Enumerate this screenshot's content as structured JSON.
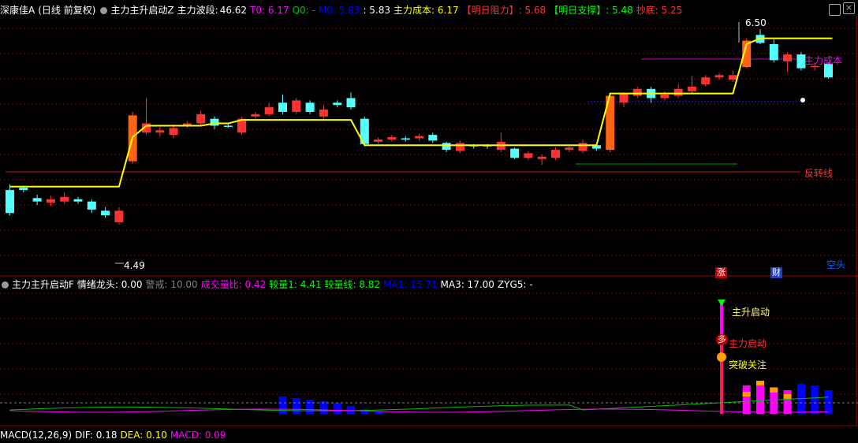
{
  "header": {
    "stock": "深康佳A",
    "period": "(日线 前复权)",
    "indicator": "主力主升启动Z",
    "wave_label": "主力波段:",
    "wave_value": "46.62",
    "t0": "T0: 6.17",
    "q0": "Q0: -",
    "m0": "M0: 5.83",
    "m0b": ": 5.83",
    "cost": "主力成本: 6.17",
    "resist": "【明日阻力】: 5.68",
    "support": "【明日支撑】: 5.48",
    "bottom": "抄底: 5.25",
    "close_icon": "×"
  },
  "labels": {
    "high": "6.50",
    "low": "4.49",
    "cost_line": "主力成本",
    "reversal_line": "反转线",
    "short": "空头",
    "zhang": "涨",
    "cai": "财"
  },
  "sub": {
    "indicator": "主力主升启动F",
    "mood": "情绪龙头: 0.00",
    "alert": "警戒: 10.00",
    "vol_ratio": "成交量比: 0.42",
    "vol1": "较量1: 4.41",
    "vol_line": "较量线: 8.82",
    "ma1": "MA1: 15.71",
    "ma3": "MA3: 17.00",
    "zyg": "ZYG5: -",
    "sig1": "主升启动",
    "sig2": "主力启动",
    "sig3": "突破关注",
    "duo": "多"
  },
  "footer": {
    "macd": "MACD(12,26,9)",
    "dif": "DIF: 0.18",
    "dea": "DEA: 0.10",
    "macd_v": "MACD: 0.09"
  },
  "colors": {
    "up": "#ff3232",
    "down": "#54ffff",
    "cost": "#ffff00",
    "grid": "#800000"
  },
  "candles": [
    {
      "o": 5.1,
      "c": 4.9,
      "h": 5.15,
      "l": 4.88
    },
    {
      "o": 5.12,
      "c": 5.1,
      "h": 5.14,
      "l": 5.08
    },
    {
      "o": 5.03,
      "c": 5.0,
      "h": 5.06,
      "l": 4.97
    },
    {
      "o": 4.99,
      "c": 5.02,
      "h": 5.05,
      "l": 4.96
    },
    {
      "o": 5.0,
      "c": 5.04,
      "h": 5.08,
      "l": 4.98
    },
    {
      "o": 5.02,
      "c": 5.0,
      "h": 5.04,
      "l": 4.98
    },
    {
      "o": 5.0,
      "c": 4.93,
      "h": 5.02,
      "l": 4.9
    },
    {
      "o": 4.92,
      "c": 4.88,
      "h": 4.95,
      "l": 4.86
    },
    {
      "o": 4.82,
      "c": 4.92,
      "h": 4.95,
      "l": 4.8
    },
    {
      "o": 5.35,
      "c": 5.75,
      "h": 5.78,
      "l": 5.33,
      "big": true
    },
    {
      "o": 5.6,
      "c": 5.68,
      "h": 5.9,
      "l": 5.58
    },
    {
      "o": 5.6,
      "c": 5.62,
      "h": 5.65,
      "l": 5.57
    },
    {
      "o": 5.58,
      "c": 5.64,
      "h": 5.67,
      "l": 5.55
    },
    {
      "o": 5.66,
      "c": 5.68,
      "h": 5.7,
      "l": 5.64
    },
    {
      "o": 5.68,
      "c": 5.76,
      "h": 5.79,
      "l": 5.66
    },
    {
      "o": 5.72,
      "c": 5.66,
      "h": 5.74,
      "l": 5.63
    },
    {
      "o": 5.66,
      "c": 5.65,
      "h": 5.68,
      "l": 5.64
    },
    {
      "o": 5.6,
      "c": 5.72,
      "h": 5.74,
      "l": 5.58
    },
    {
      "o": 5.74,
      "c": 5.76,
      "h": 5.78,
      "l": 5.72
    },
    {
      "o": 5.76,
      "c": 5.82,
      "h": 5.86,
      "l": 5.74
    },
    {
      "o": 5.86,
      "c": 5.78,
      "h": 5.93,
      "l": 5.76
    },
    {
      "o": 5.78,
      "c": 5.88,
      "h": 5.9,
      "l": 5.76
    },
    {
      "o": 5.86,
      "c": 5.78,
      "h": 5.88,
      "l": 5.76
    },
    {
      "o": 5.74,
      "c": 5.8,
      "h": 5.84,
      "l": 5.72
    },
    {
      "o": 5.86,
      "c": 5.84,
      "h": 5.88,
      "l": 5.82
    },
    {
      "o": 5.9,
      "c": 5.82,
      "h": 5.95,
      "l": 5.8
    },
    {
      "o": 5.72,
      "c": 5.5,
      "h": 5.74,
      "l": 5.48
    },
    {
      "o": 5.52,
      "c": 5.54,
      "h": 5.56,
      "l": 5.5
    },
    {
      "o": 5.54,
      "c": 5.56,
      "h": 5.58,
      "l": 5.52
    },
    {
      "o": 5.55,
      "c": 5.54,
      "h": 5.57,
      "l": 5.52
    },
    {
      "o": 5.55,
      "c": 5.57,
      "h": 5.59,
      "l": 5.53
    },
    {
      "o": 5.58,
      "c": 5.53,
      "h": 5.6,
      "l": 5.51
    },
    {
      "o": 5.51,
      "c": 5.45,
      "h": 5.52,
      "l": 5.43
    },
    {
      "o": 5.44,
      "c": 5.51,
      "h": 5.53,
      "l": 5.42
    },
    {
      "o": 5.49,
      "c": 5.48,
      "h": 5.5,
      "l": 5.46
    },
    {
      "o": 5.49,
      "c": 5.48,
      "h": 5.5,
      "l": 5.46
    },
    {
      "o": 5.45,
      "c": 5.52,
      "h": 5.6,
      "l": 5.43
    },
    {
      "o": 5.46,
      "c": 5.38,
      "h": 5.47,
      "l": 5.37
    },
    {
      "o": 5.38,
      "c": 5.42,
      "h": 5.44,
      "l": 5.36
    },
    {
      "o": 5.37,
      "c": 5.39,
      "h": 5.41,
      "l": 5.32
    },
    {
      "o": 5.38,
      "c": 5.45,
      "h": 5.47,
      "l": 5.36
    },
    {
      "o": 5.45,
      "c": 5.47,
      "h": 5.49,
      "l": 5.43
    },
    {
      "o": 5.44,
      "c": 5.51,
      "h": 5.54,
      "l": 5.42
    },
    {
      "o": 5.49,
      "c": 5.46,
      "h": 5.5,
      "l": 5.44
    },
    {
      "o": 5.45,
      "c": 5.92,
      "h": 5.94,
      "l": 5.43,
      "big": true
    },
    {
      "o": 5.86,
      "c": 5.94,
      "h": 5.95,
      "l": 5.82
    },
    {
      "o": 5.92,
      "c": 5.98,
      "h": 6.0,
      "l": 5.9
    },
    {
      "o": 5.98,
      "c": 5.9,
      "h": 6.0,
      "l": 5.86
    },
    {
      "o": 5.9,
      "c": 5.93,
      "h": 5.96,
      "l": 5.88
    },
    {
      "o": 5.92,
      "c": 5.98,
      "h": 6.02,
      "l": 5.9
    },
    {
      "o": 5.96,
      "c": 6.0,
      "h": 6.09,
      "l": 5.94
    },
    {
      "o": 6.02,
      "c": 6.08,
      "h": 6.1,
      "l": 6.0
    },
    {
      "o": 6.08,
      "c": 6.1,
      "h": 6.12,
      "l": 6.06
    },
    {
      "o": 6.06,
      "c": 6.1,
      "h": 6.14,
      "l": 6.04
    },
    {
      "o": 6.17,
      "c": 6.4,
      "h": 6.42,
      "l": 6.16,
      "big": true
    },
    {
      "o": 6.45,
      "c": 6.38,
      "h": 6.5,
      "l": 6.37
    },
    {
      "o": 6.37,
      "c": 6.23,
      "h": 6.41,
      "l": 6.21
    },
    {
      "o": 6.22,
      "c": 6.28,
      "h": 6.3,
      "l": 6.13
    },
    {
      "o": 6.28,
      "c": 6.16,
      "h": 6.3,
      "l": 6.14
    },
    {
      "o": 6.17,
      "c": 6.18,
      "h": 6.21,
      "l": 6.14
    },
    {
      "o": 6.2,
      "c": 6.08,
      "h": 6.21,
      "l": 6.07
    }
  ],
  "cost_path": [
    5.13,
    5.13,
    5.13,
    5.13,
    5.13,
    5.13,
    5.13,
    5.13,
    5.13,
    5.56,
    5.66,
    5.66,
    5.66,
    5.66,
    5.66,
    5.68,
    5.68,
    5.71,
    5.71,
    5.71,
    5.71,
    5.71,
    5.71,
    5.71,
    5.71,
    5.71,
    5.49,
    5.49,
    5.49,
    5.49,
    5.49,
    5.49,
    5.49,
    5.49,
    5.49,
    5.49,
    5.49,
    5.49,
    5.49,
    5.49,
    5.49,
    5.49,
    5.49,
    5.49,
    5.94,
    5.94,
    5.94,
    5.94,
    5.94,
    5.94,
    5.94,
    5.94,
    5.94,
    5.94,
    6.37,
    6.42,
    6.42,
    6.42,
    6.42,
    6.42,
    6.42
  ],
  "sub_bars": [
    {
      "i": 20,
      "v": 0.55,
      "c": "#0000ff"
    },
    {
      "i": 21,
      "v": 0.5,
      "c": "#0000ff"
    },
    {
      "i": 22,
      "v": 0.45,
      "c": "#0000ff"
    },
    {
      "i": 23,
      "v": 0.4,
      "c": "#0000ff"
    },
    {
      "i": 24,
      "v": 0.35,
      "c": "#0000ff"
    },
    {
      "i": 25,
      "v": 0.25,
      "c": "#0000ff"
    },
    {
      "i": 26,
      "v": 0.15,
      "c": "#0000ff"
    },
    {
      "i": 27,
      "v": 0.08,
      "c": "#0000ff"
    },
    {
      "i": 54,
      "v": 0.9,
      "c": "#ff00ff"
    },
    {
      "i": 55,
      "v": 1.0,
      "c": "#ff00ff"
    },
    {
      "i": 56,
      "v": 0.85,
      "c": "#ff00ff"
    },
    {
      "i": 57,
      "v": 0.75,
      "c": "#ff00ff"
    },
    {
      "i": 58,
      "v": 0.95,
      "c": "#0000ff"
    },
    {
      "i": 59,
      "v": 0.9,
      "c": "#0000ff"
    },
    {
      "i": 60,
      "v": 0.75,
      "c": "#0000ff"
    }
  ]
}
